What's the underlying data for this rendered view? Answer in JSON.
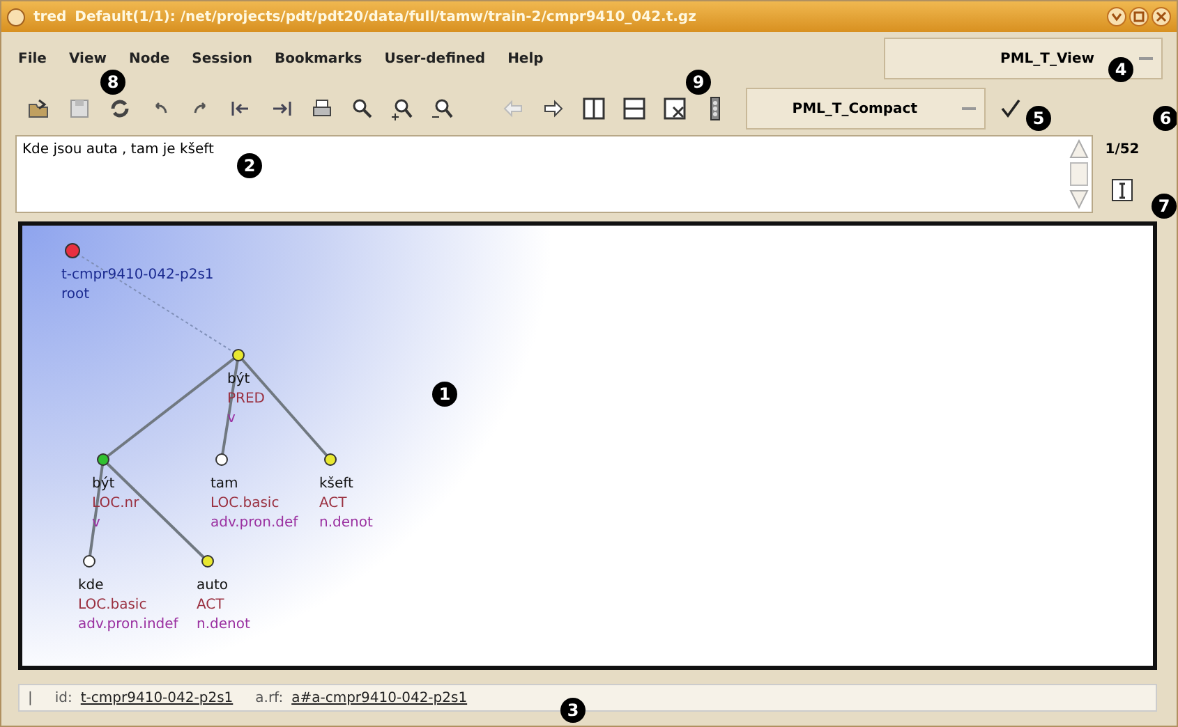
{
  "window": {
    "app": "tred",
    "title": "Default(1/1): /net/projects/pdt/pdt20/data/full/tamw/train-2/cmpr9410_042.t.gz"
  },
  "menu": [
    {
      "label": "File"
    },
    {
      "label": "View"
    },
    {
      "label": "Node"
    },
    {
      "label": "Session"
    },
    {
      "label": "Bookmarks"
    },
    {
      "label": "User-defined"
    },
    {
      "label": "Help"
    }
  ],
  "view_select": {
    "value": "PML_T_View"
  },
  "style_select": {
    "value": "PML_T_Compact"
  },
  "sentence": {
    "value": "Kde jsou auta , tam je kšeft"
  },
  "tree_counter": "1/52",
  "tree": {
    "color": "#e83040",
    "labels": [
      {
        "text": "t-cmpr9410-042-p2s1",
        "kind": "id"
      },
      {
        "text": "root",
        "kind": "id"
      }
    ],
    "children": [
      {
        "color": "#e8e830",
        "labels": [
          {
            "text": "být",
            "kind": "lemma"
          },
          {
            "text": "PRED",
            "kind": "functor"
          },
          {
            "text": "v",
            "kind": "type"
          }
        ],
        "children": [
          {
            "color": "#30c030",
            "labels": [
              {
                "text": "být",
                "kind": "lemma"
              },
              {
                "text": "LOC.nr",
                "kind": "functor"
              },
              {
                "text": "v",
                "kind": "type"
              }
            ],
            "children": [
              {
                "color": "#ffffff",
                "labels": [
                  {
                    "text": "kde",
                    "kind": "lemma"
                  },
                  {
                    "text": "LOC.basic",
                    "kind": "functor"
                  },
                  {
                    "text": "adv.pron.indef",
                    "kind": "type"
                  }
                ]
              },
              {
                "color": "#e8e830",
                "labels": [
                  {
                    "text": "auto",
                    "kind": "lemma"
                  },
                  {
                    "text": "ACT",
                    "kind": "functor"
                  },
                  {
                    "text": "n.denot",
                    "kind": "type"
                  }
                ]
              }
            ]
          },
          {
            "color": "#ffffff",
            "labels": [
              {
                "text": "tam",
                "kind": "lemma"
              },
              {
                "text": "LOC.basic",
                "kind": "functor"
              },
              {
                "text": "adv.pron.def",
                "kind": "type"
              }
            ]
          },
          {
            "color": "#e8e830",
            "labels": [
              {
                "text": "kšeft",
                "kind": "lemma"
              },
              {
                "text": "ACT",
                "kind": "functor"
              },
              {
                "text": "n.denot",
                "kind": "type"
              }
            ]
          }
        ]
      }
    ]
  },
  "status": {
    "separator": "|",
    "id_label": "id:",
    "id": "t-cmpr9410-042-p2s1",
    "arf_label": "a.rf:",
    "arf": "a#a-cmpr9410-042-p2s1"
  },
  "callouts": [
    {
      "label": "1"
    },
    {
      "label": "2"
    },
    {
      "label": "3"
    },
    {
      "label": "4"
    },
    {
      "label": "5"
    },
    {
      "label": "6"
    },
    {
      "label": "7"
    },
    {
      "label": "8"
    },
    {
      "label": "9"
    }
  ]
}
